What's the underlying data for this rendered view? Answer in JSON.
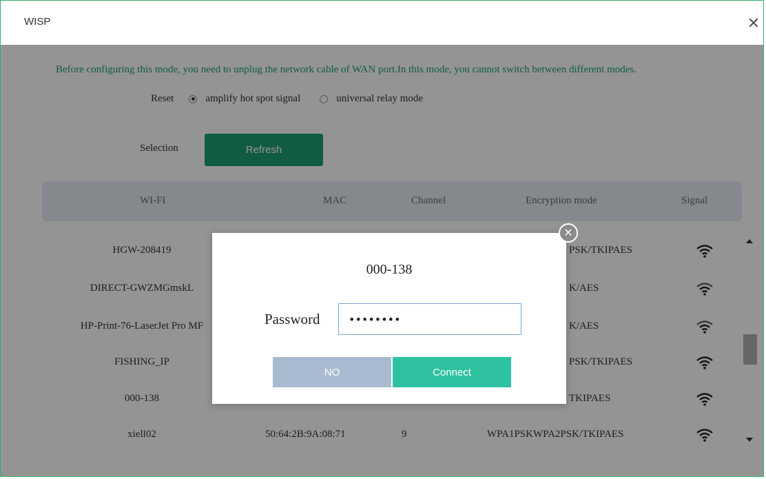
{
  "window": {
    "title": "WISP",
    "close_icon": "close-icon"
  },
  "notice": "Before configuring this mode, you need to unplug the network cable of WAN port.In this mode, you cannot switch between different modes.",
  "mode": {
    "label": "Reset",
    "options": [
      {
        "label": "amplify hot spot signal",
        "selected": true
      },
      {
        "label": "universal relay mode",
        "selected": false
      }
    ]
  },
  "selection": {
    "label": "Selection",
    "refresh_label": "Refresh"
  },
  "table": {
    "headers": [
      "WI-FI",
      "MAC",
      "Channel",
      "Encryption mode",
      "Signal"
    ],
    "rows": [
      {
        "ssid": "HGW-208419",
        "mac": "",
        "channel": "",
        "encryption": "PSK/TKIPAES",
        "signal": "wifi-strong-icon"
      },
      {
        "ssid": "DIRECT-GWZMGmskL",
        "mac": "",
        "channel": "",
        "encryption": "K/AES",
        "signal": "wifi-medium-icon"
      },
      {
        "ssid": "HP-Print-76-LaserJet Pro MF",
        "mac": "",
        "channel": "",
        "encryption": "K/AES",
        "signal": "wifi-medium-icon"
      },
      {
        "ssid": "FISHING_IP",
        "mac": "",
        "channel": "",
        "encryption": "PSK/TKIPAES",
        "signal": "wifi-strong-icon"
      },
      {
        "ssid": "000-138",
        "mac": "",
        "channel": "",
        "encryption": "TKIPAES",
        "signal": "wifi-strong-icon"
      },
      {
        "ssid": "xiell02",
        "mac": "50:64:2B:9A:08:71",
        "channel": "9",
        "encryption": "WPA1PSKWPA2PSK/TKIPAES",
        "signal": "wifi-strong-icon"
      }
    ]
  },
  "dialog": {
    "title": "000-138",
    "password_label": "Password",
    "password_value": "••••••••",
    "no_label": "NO",
    "connect_label": "Connect"
  },
  "colors": {
    "accent": "#1c9e74",
    "connect": "#2ec2a0",
    "no": "#a9bbd0",
    "frame": "#2fb36a"
  }
}
